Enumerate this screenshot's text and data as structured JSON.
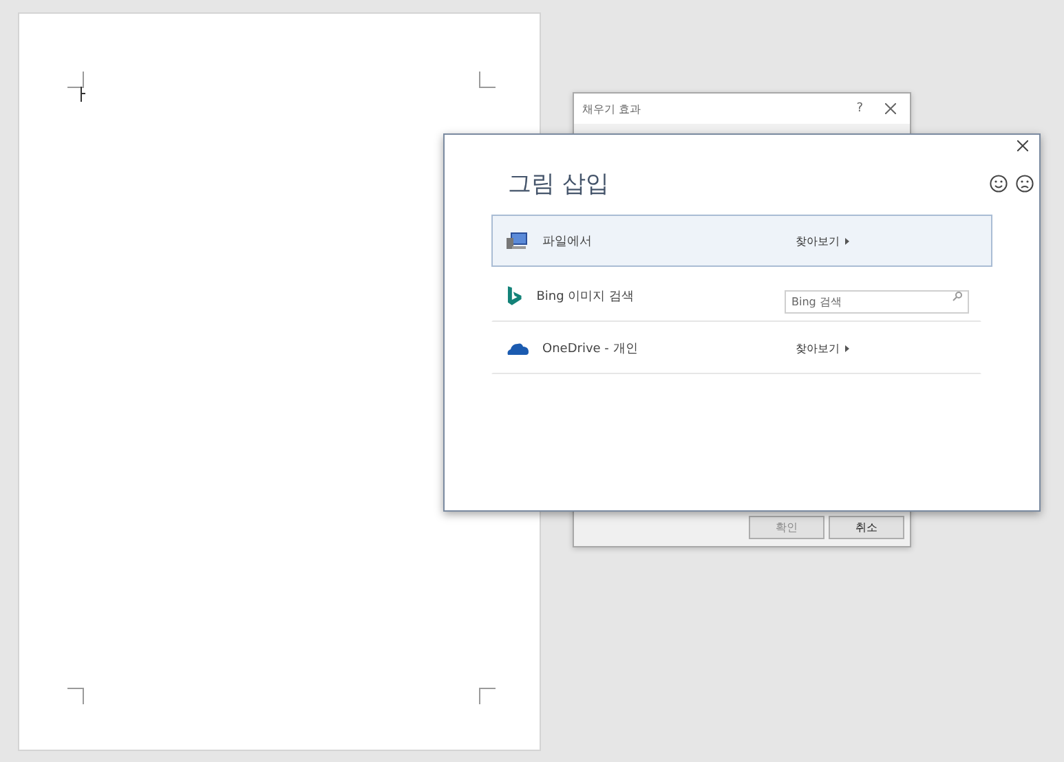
{
  "back_dialog": {
    "title": "채우기 효과",
    "help": "?",
    "buttons": [
      {
        "label": "확인",
        "disabled": true
      },
      {
        "label": "취소",
        "disabled": false
      }
    ]
  },
  "insert_dialog": {
    "title": "그림 삽입",
    "sources": [
      {
        "kind": "file",
        "label": "파일에서",
        "action": "찾아보기",
        "selected": true
      },
      {
        "kind": "search",
        "label": "Bing 이미지 검색",
        "placeholder": "Bing 검색",
        "selected": false
      },
      {
        "kind": "cloud",
        "label": "OneDrive - 개인",
        "action": "찾아보기",
        "selected": false
      }
    ]
  }
}
